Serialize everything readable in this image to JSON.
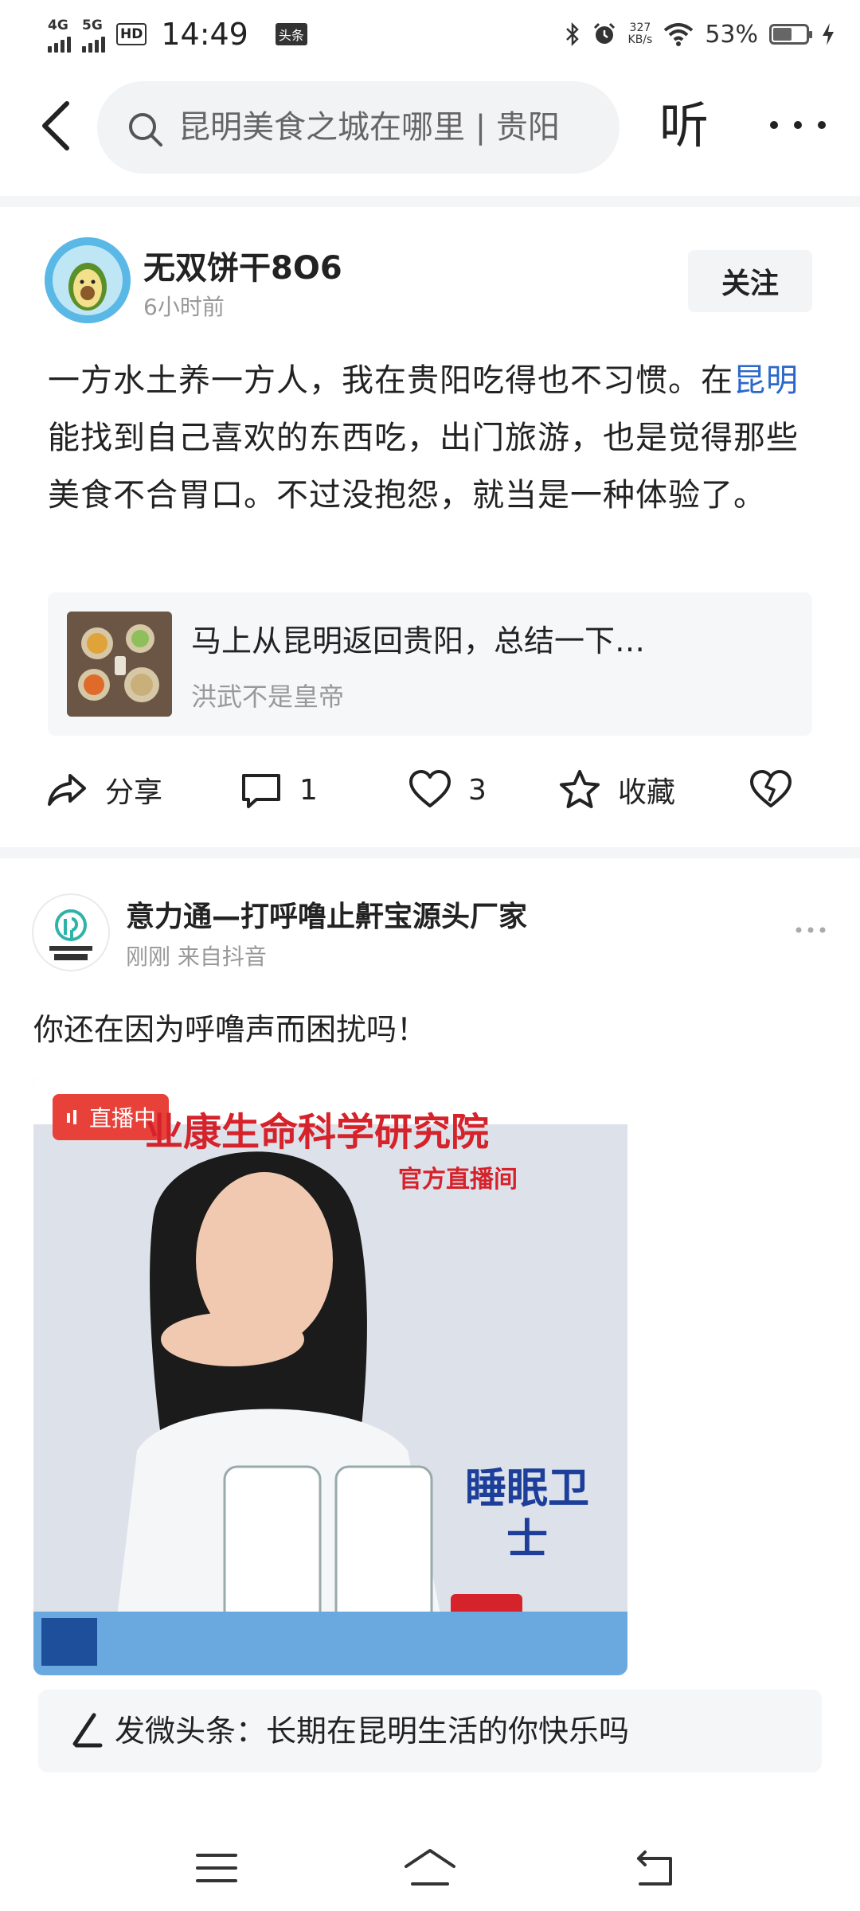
{
  "status_bar": {
    "network1": "4G",
    "network2": "5G",
    "hd": "HD",
    "time": "14:49",
    "app_badge": "头条",
    "speed_value": "327",
    "speed_unit": "KB/s",
    "battery": "53%"
  },
  "top_bar": {
    "search_text": "昆明美食之城在哪里 | 贵阳",
    "listen_label": "听"
  },
  "post1": {
    "author": "无双饼干8O6",
    "time": "6小时前",
    "follow_label": "关注",
    "body_pre": "一方水土养一方人，我在贵阳吃得也不习惯。在",
    "body_link": "昆明",
    "body_post": "能找到自己喜欢的东西吃，出门旅游，也是觉得那些美食不合胃口。不过没抱怨，就当是一种体验了。",
    "ref_title": "马上从昆明返回贵阳，总结一下…",
    "ref_author": "洪武不是皇帝",
    "actions": {
      "share": "分享",
      "comments": "1",
      "likes": "3",
      "favorite": "收藏"
    }
  },
  "post2": {
    "author": "意力通—打呼噜止鼾宝源头厂家",
    "meta": "刚刚 来自抖音",
    "text": "你还在因为呼噜声而困扰吗！",
    "live_badge": "直播中",
    "overlay_title": "业康生命科学研究院",
    "overlay_subtitle": "官方直播间",
    "overlay_label": "睡眠卫士"
  },
  "compose": {
    "text": "发微头条：长期在昆明生活的你快乐吗"
  }
}
